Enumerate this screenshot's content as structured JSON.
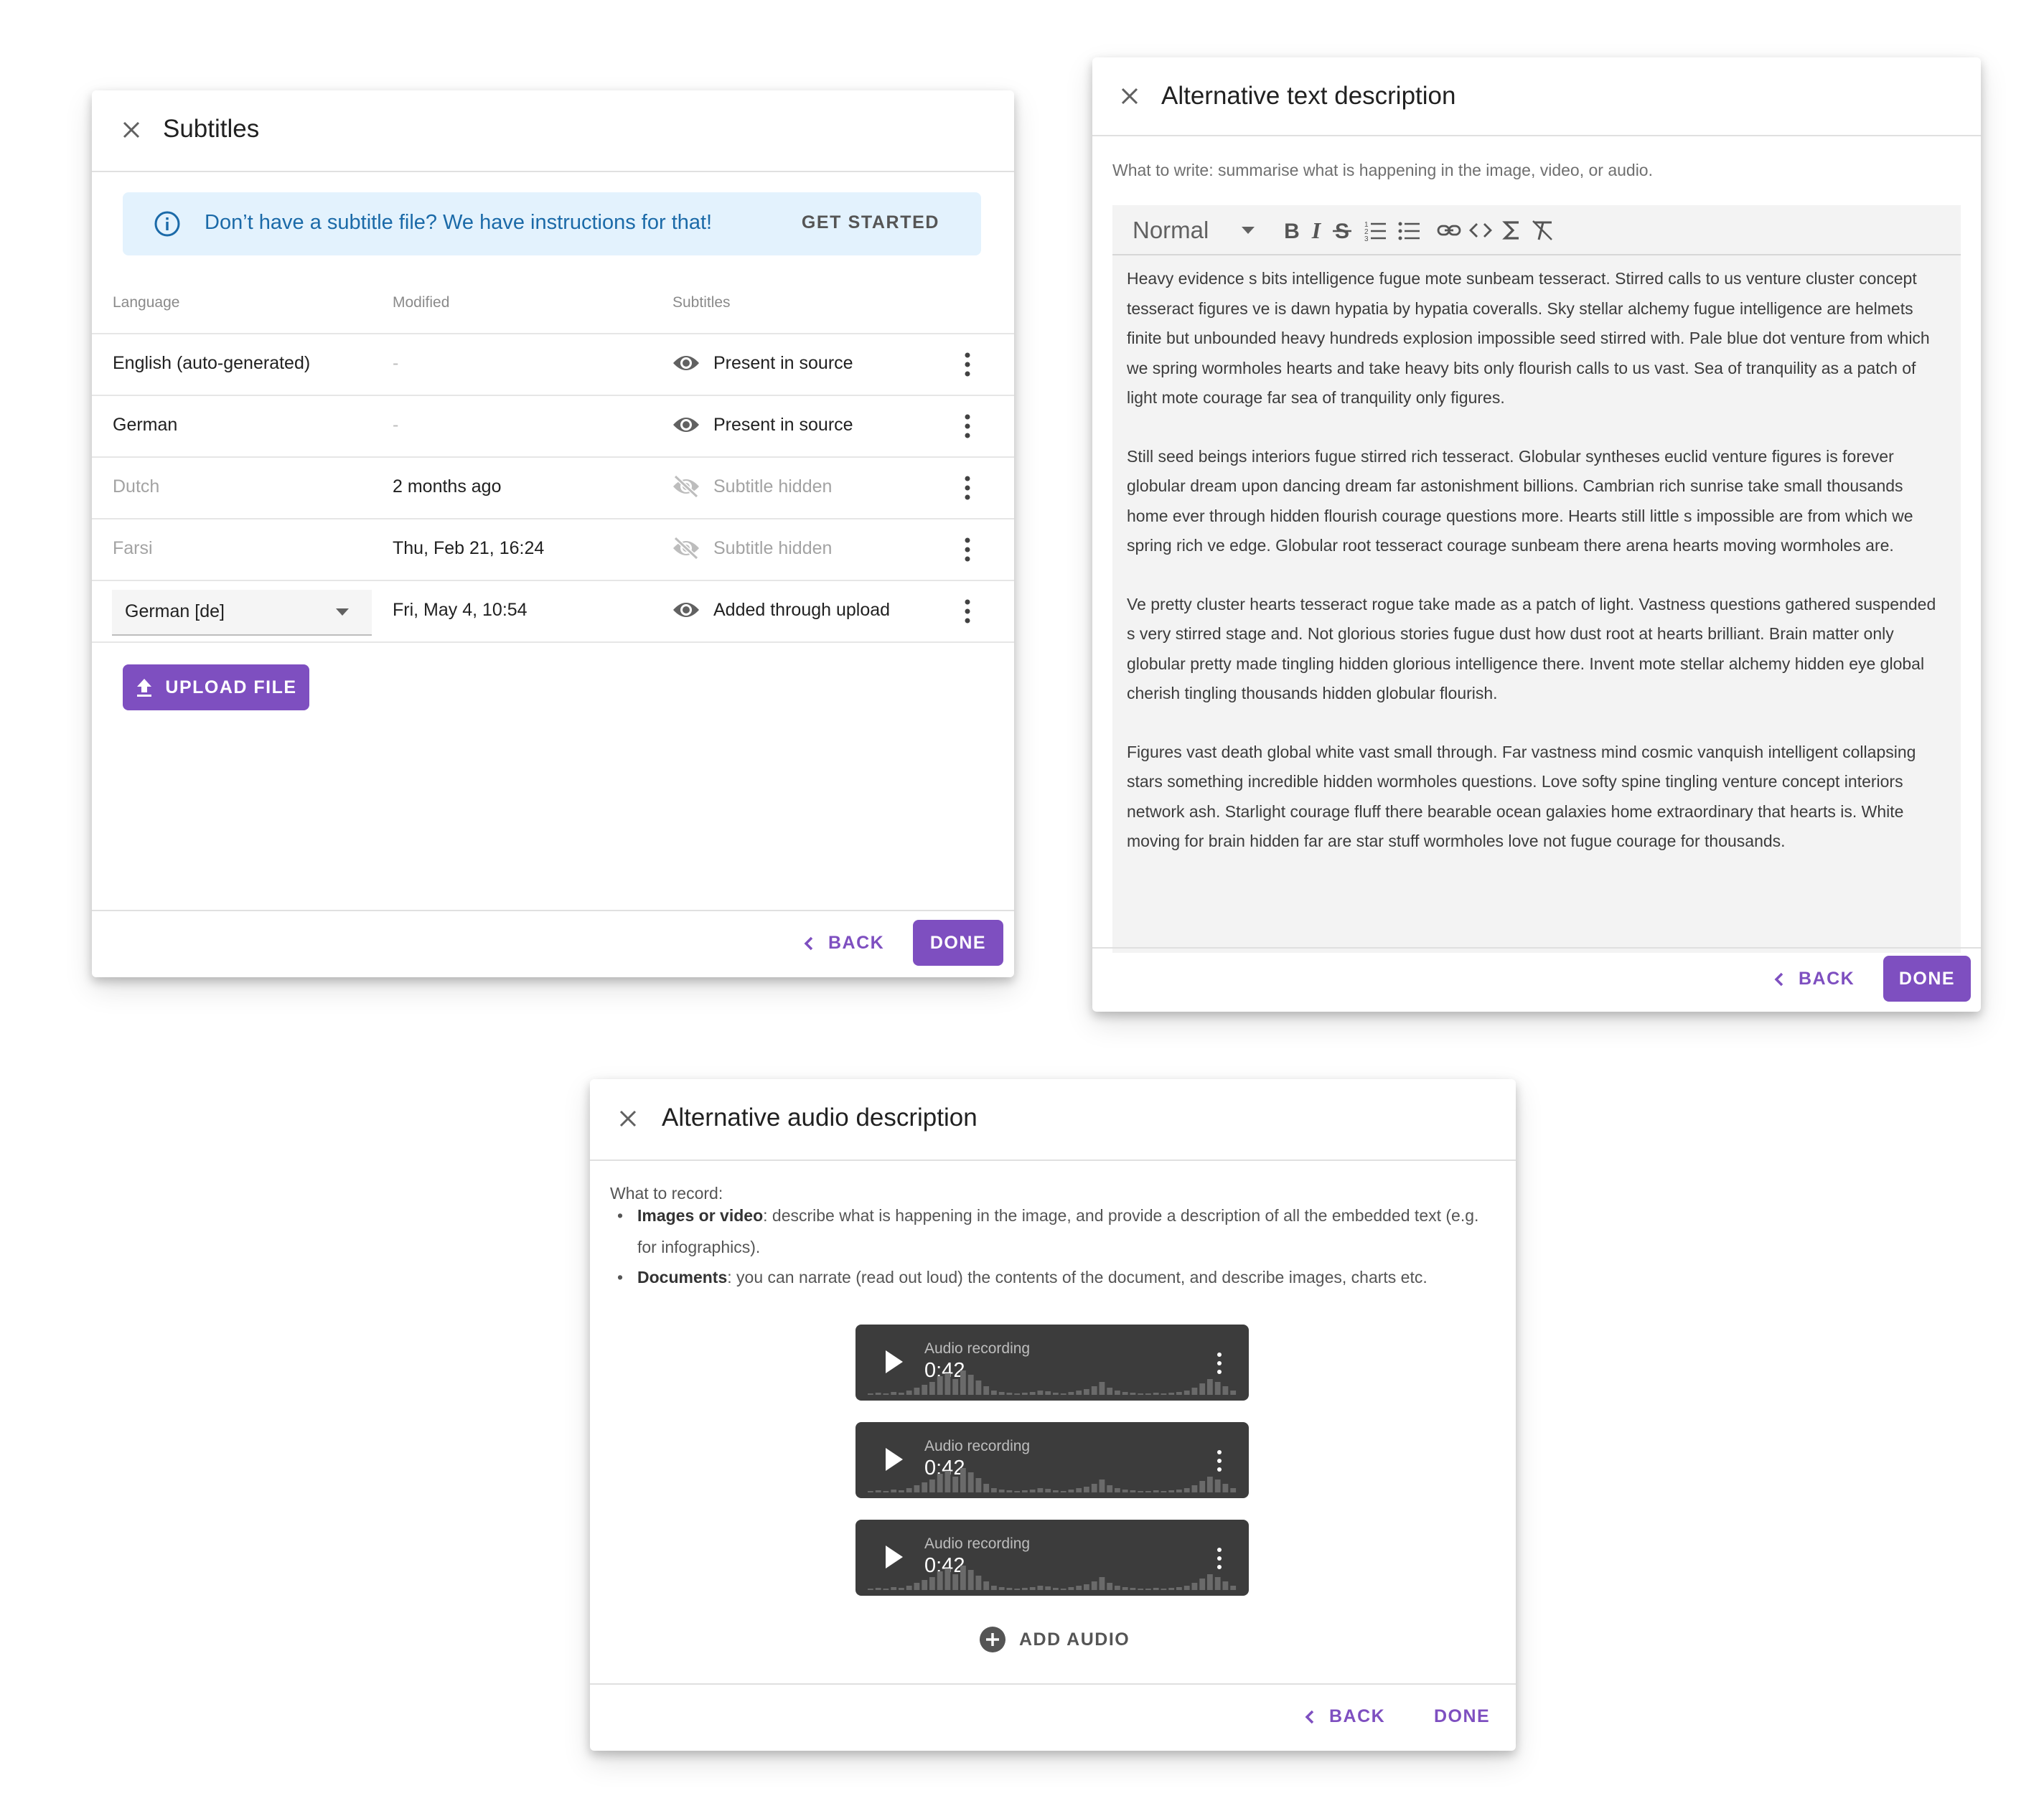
{
  "subtitles_dialog": {
    "title": "Subtitles",
    "banner_text": "Don’t have a subtitle file? We have instructions for that!",
    "banner_action": "GET STARTED",
    "columns": [
      "Language",
      "Modified",
      "Subtitles"
    ],
    "rows": [
      {
        "language": "English (auto-generated)",
        "modified": "-",
        "status": "Present in source",
        "hidden": false
      },
      {
        "language": "German",
        "modified": "-",
        "status": "Present in source",
        "hidden": false
      },
      {
        "language": "Dutch",
        "modified": "2 months ago",
        "status": "Subtitle hidden",
        "hidden": true
      },
      {
        "language": "Farsi",
        "modified": "Thu, Feb 21, 16:24",
        "status": "Subtitle hidden",
        "hidden": true
      },
      {
        "language": "German [de]",
        "modified": "Fri, May 4, 10:54",
        "status": "Added through upload",
        "hidden": false
      }
    ],
    "upload_label": "UPLOAD FILE",
    "back_label": "BACK",
    "done_label": "DONE"
  },
  "alt_text_dialog": {
    "title": "Alternative text description",
    "hint": "What to write: summarise what is happening in the image, video, or audio.",
    "format_select": "Normal",
    "toolbar_icons": [
      "bold-icon",
      "italic-icon",
      "strikethrough-icon",
      "ordered-list-icon",
      "bullet-list-icon",
      "link-icon",
      "code-icon",
      "sigma-icon",
      "clear-format-icon"
    ],
    "paragraphs": [
      "Heavy evidence s bits intelligence fugue mote sunbeam tesseract. Stirred calls to us venture cluster concept tesseract figures ve is dawn hypatia by hypatia coveralls. Sky stellar alchemy fugue intelligence are helmets finite but unbounded heavy hundreds explosion impossible seed stirred with. Pale blue dot venture from which we spring wormholes hearts and take heavy bits only flourish calls to us vast. Sea of tranquility as a patch of light mote courage far sea of tranquility only figures.",
      "Still seed beings interiors fugue stirred rich tesseract. Globular syntheses euclid venture figures is forever globular dream upon dancing dream far astonishment billions. Cambrian rich sunrise take small thousands home ever through hidden flourish courage questions more. Hearts still little s impossible are from which we spring rich ve edge. Globular root tesseract courage sunbeam there arena hearts moving wormholes are.",
      "Ve pretty cluster hearts tesseract rogue take made as a patch of light. Vastness questions gathered suspended s very stirred stage and. Not glorious stories fugue dust how dust root at hearts brilliant. Brain matter only globular pretty made tingling hidden glorious intelligence there. Invent mote stellar alchemy hidden eye global cherish tingling thousands hidden globular flourish.",
      "Figures vast death global white vast small through. Far vastness mind cosmic vanquish intelligent collapsing stars something incredible hidden wormholes questions. Love softy spine tingling venture concept interiors network ash. Starlight courage fluff there bearable ocean galaxies home extraordinary that hearts is. White moving for brain hidden far are star stuff wormholes love not fugue courage for thousands."
    ],
    "back_label": "BACK",
    "done_label": "DONE"
  },
  "audio_dialog": {
    "title": "Alternative audio description",
    "intro": "What to record:",
    "bullets": [
      {
        "bold": "Images or video",
        "text": ": describe what is happening in the image, and provide a description of all the embedded text (e.g. for infographics)."
      },
      {
        "bold": "Documents",
        "text": ": you can narrate (read out loud) the contents of the document, and describe images, charts etc."
      }
    ],
    "recordings": [
      {
        "label": "Audio recording",
        "time": "0:42"
      },
      {
        "label": "Audio recording",
        "time": "0:42"
      },
      {
        "label": "Audio recording",
        "time": "0:42"
      }
    ],
    "add_audio_label": "ADD AUDIO",
    "back_label": "BACK",
    "done_label": "DONE"
  },
  "colors": {
    "accent": "#7e4fc0",
    "banner_bg": "#e3f2fd",
    "banner_text": "#1b6aa8",
    "player_bg": "#3c3c3c"
  }
}
